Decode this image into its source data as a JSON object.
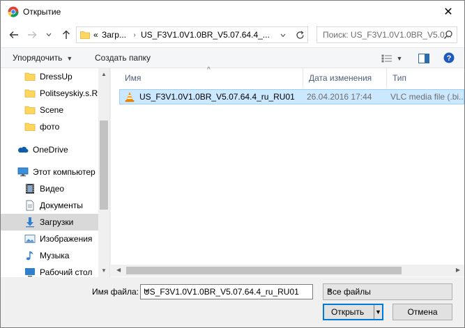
{
  "window": {
    "title": "Открытие",
    "close_label": "✕"
  },
  "nav": {
    "address": {
      "prefix": "«",
      "crumb_1": "Загр...",
      "crumb_2": "US_F3V1.0V1.0BR_V5.07.64.4_..."
    },
    "search_placeholder": "Поиск: US_F3V1.0V1.0BR_V5.0..."
  },
  "commands": {
    "organize": "Упорядочить",
    "new_folder": "Создать папку"
  },
  "sidebar": {
    "items": [
      {
        "label": "DressUp",
        "icon": "folder-icon"
      },
      {
        "label": "Politseyskiy.s.Ru",
        "icon": "folder-icon"
      },
      {
        "label": "Scene",
        "icon": "folder-icon"
      },
      {
        "label": "фото",
        "icon": "folder-icon"
      },
      {
        "label": "OneDrive",
        "icon": "onedrive-icon"
      },
      {
        "label": "Этот компьютер",
        "icon": "computer-icon"
      },
      {
        "label": "Видео",
        "icon": "video-icon"
      },
      {
        "label": "Документы",
        "icon": "documents-icon"
      },
      {
        "label": "Загрузки",
        "icon": "downloads-icon",
        "selected": true
      },
      {
        "label": "Изображения",
        "icon": "pictures-icon"
      },
      {
        "label": "Музыка",
        "icon": "music-icon"
      },
      {
        "label": "Рабочий стол",
        "icon": "desktop-icon"
      }
    ]
  },
  "filelist": {
    "columns": [
      "Имя",
      "Дата изменения",
      "Тип"
    ],
    "rows": [
      {
        "name": "US_F3V1.0V1.0BR_V5.07.64.4_ru_RU01",
        "date": "26.04.2016 17:44",
        "type": "VLC media file (.bi..."
      }
    ]
  },
  "bottom": {
    "filename_label": "Имя файла:",
    "filename_value": "US_F3V1.0V1.0BR_V5.07.64.4_ru_RU01",
    "filter_value": "Все файлы",
    "open_label": "Открыть",
    "cancel_label": "Отмена"
  },
  "colors": {
    "accent": "#0078d7",
    "selection": "#cce8ff",
    "folder": "#ffd75e"
  }
}
